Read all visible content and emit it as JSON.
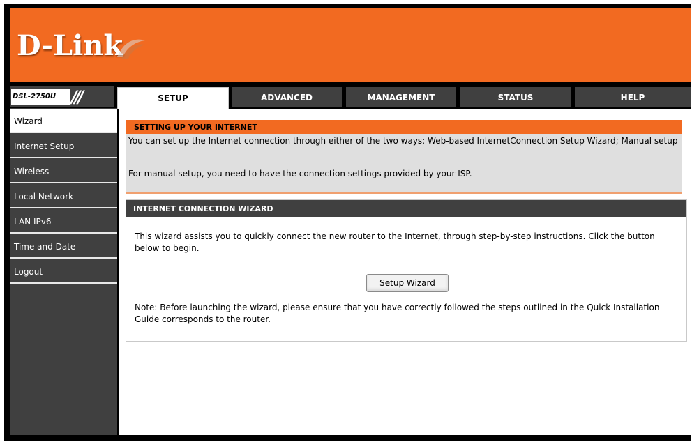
{
  "brand": {
    "logo_text": "D-Link",
    "color_orange": "#f26a21",
    "color_dark": "#404040"
  },
  "model": {
    "name": "DSL-2750U",
    "slashes": "///"
  },
  "tabs": [
    {
      "label": "SETUP",
      "active": true
    },
    {
      "label": "ADVANCED",
      "active": false
    },
    {
      "label": "MANAGEMENT",
      "active": false
    },
    {
      "label": "STATUS",
      "active": false
    },
    {
      "label": "HELP",
      "active": false
    }
  ],
  "sidebar": {
    "items": [
      {
        "label": "Wizard",
        "active": true
      },
      {
        "label": "Internet Setup"
      },
      {
        "label": "Wireless"
      },
      {
        "label": "Local Network"
      },
      {
        "label": "LAN IPv6"
      },
      {
        "label": "Time and Date"
      },
      {
        "label": "Logout"
      }
    ]
  },
  "notice": {
    "title": "SETTING UP YOUR INTERNET",
    "line1": "You can set up the Internet connection through either of the two ways: Web-based InternetConnection Setup Wizard; Manual setup",
    "line2": "For manual setup, you need to have the connection settings provided by your ISP."
  },
  "wizard": {
    "title": "INTERNET CONNECTION WIZARD",
    "description": "This wizard assists you to quickly connect the new router to the Internet, through step-by-step instructions. Click the button below to begin.",
    "button_label": "Setup Wizard",
    "note": "Note: Before launching the wizard, please ensure that you have correctly followed the steps outlined in the Quick Installation Guide corresponds to the router."
  }
}
